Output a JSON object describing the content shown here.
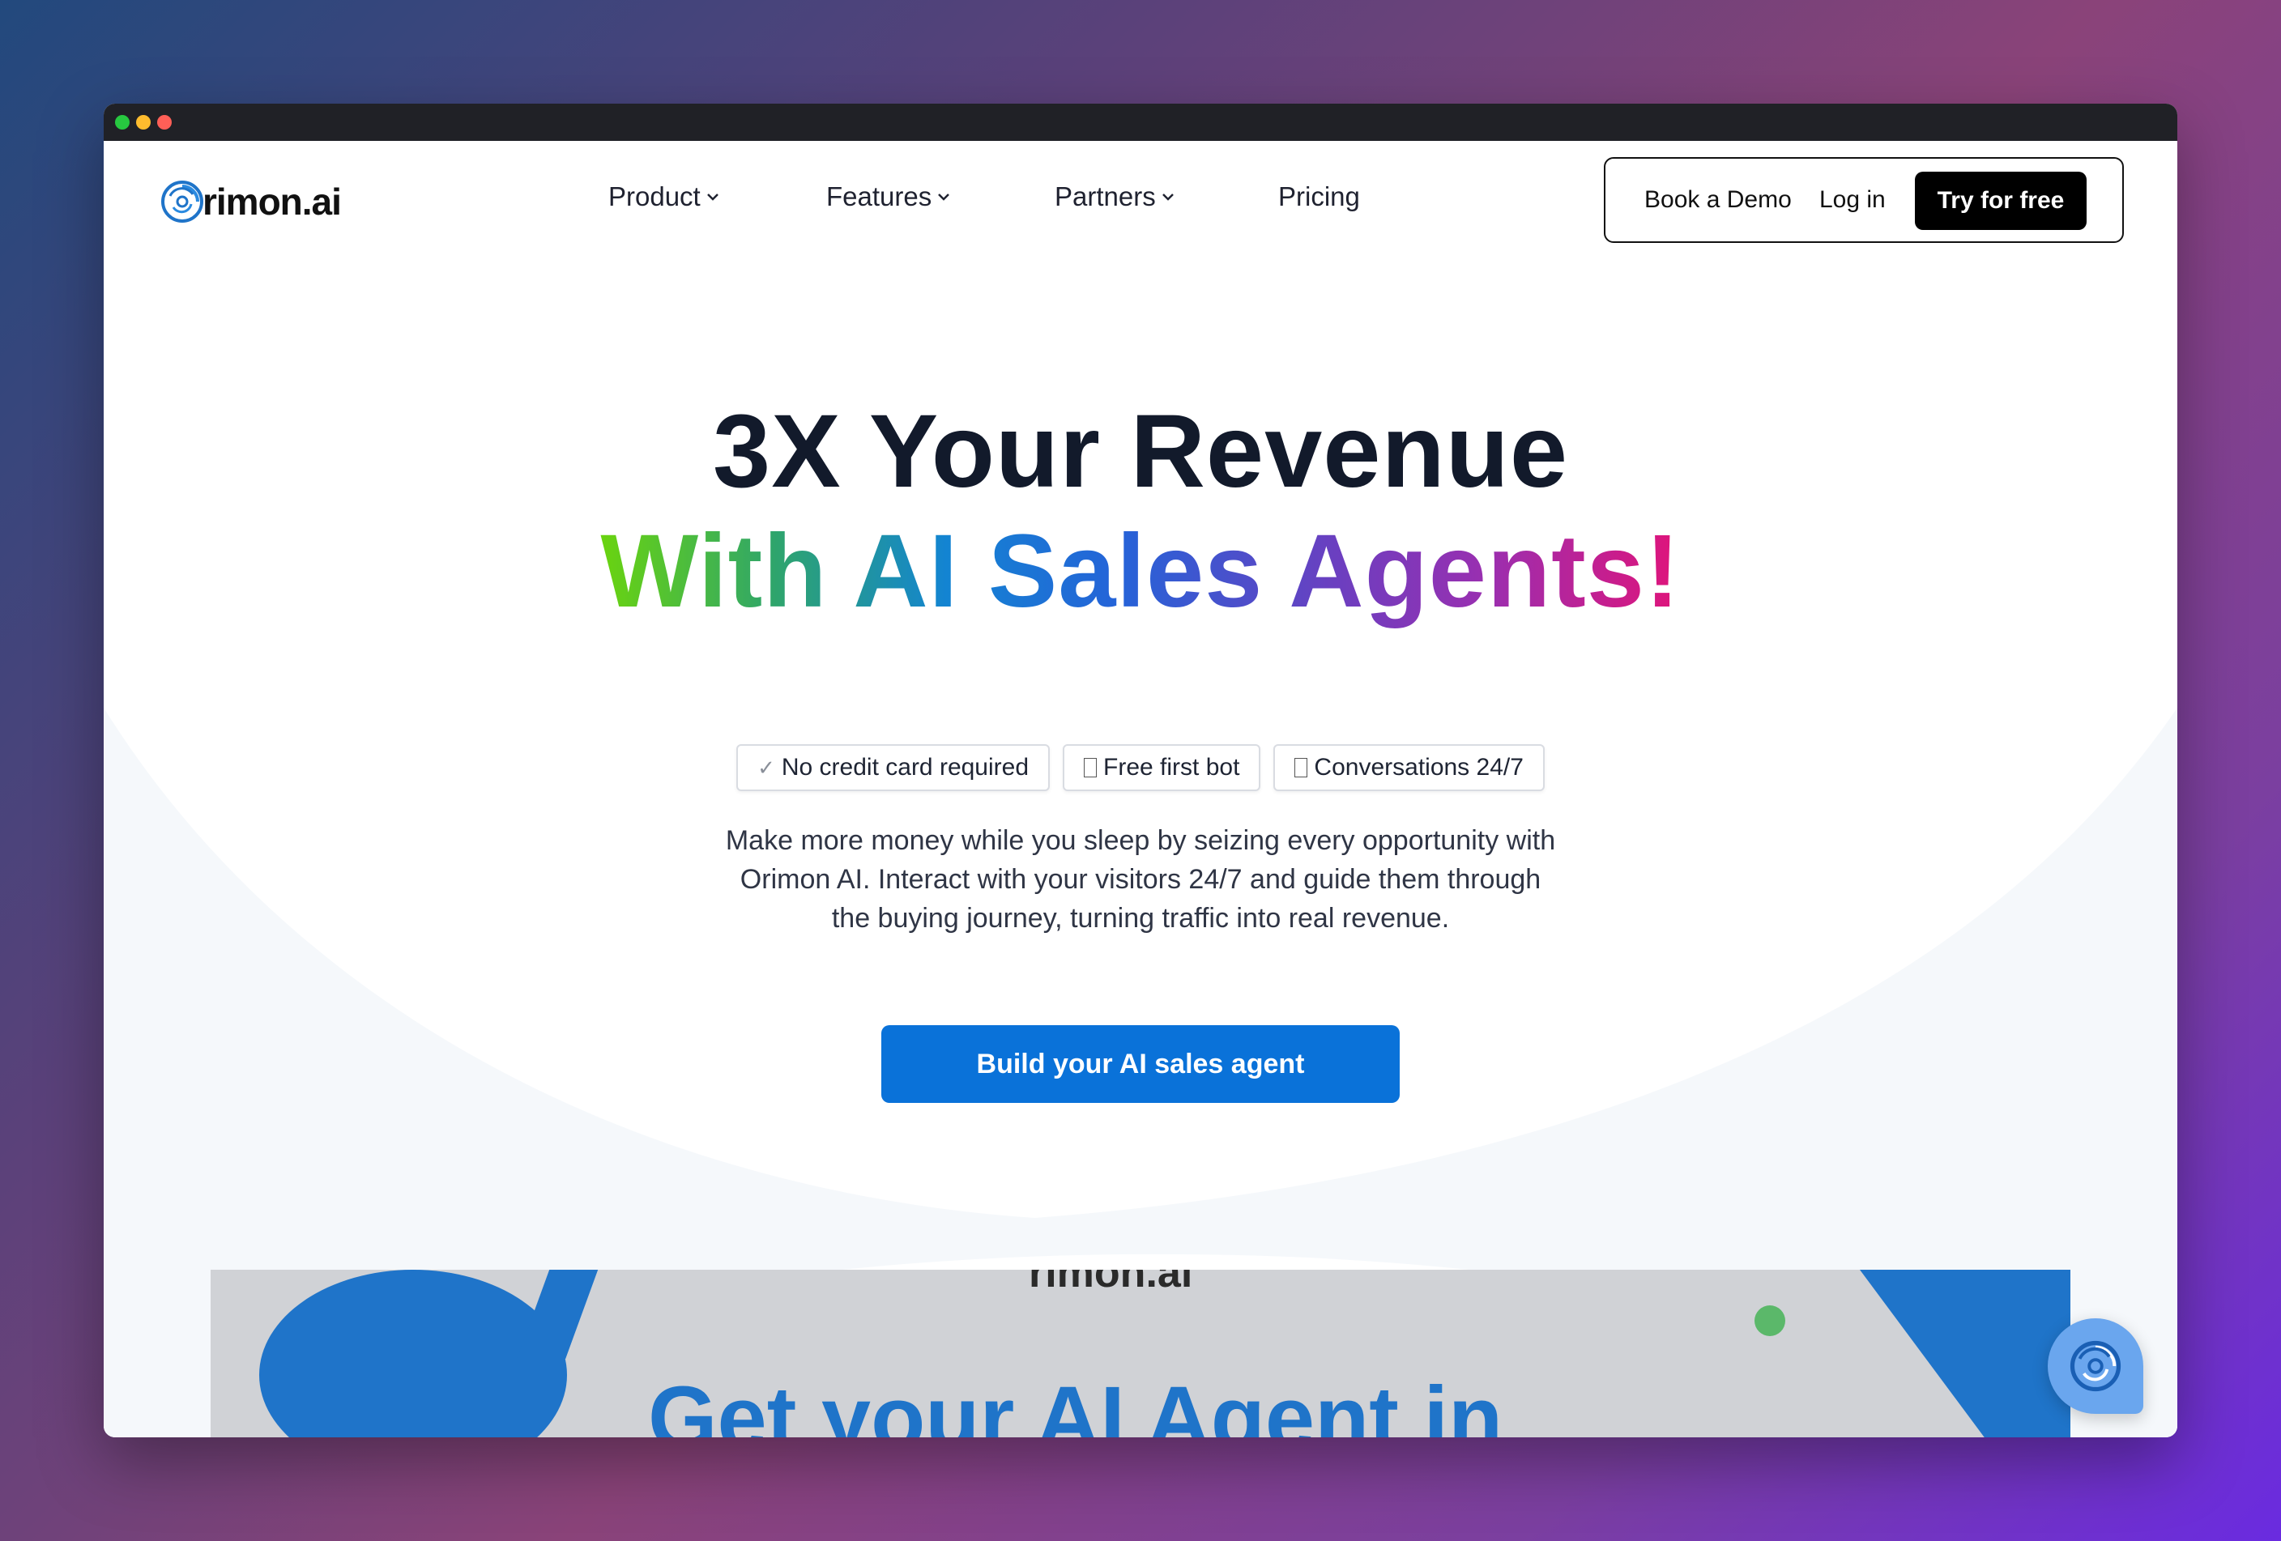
{
  "window": {
    "controls": [
      "close",
      "minimize",
      "maximize"
    ]
  },
  "nav": {
    "logo_text": "rimon.ai",
    "items": [
      {
        "label": "Product",
        "has_dropdown": true
      },
      {
        "label": "Features",
        "has_dropdown": true
      },
      {
        "label": "Partners",
        "has_dropdown": true
      },
      {
        "label": "Pricing",
        "has_dropdown": false
      }
    ],
    "book_demo": "Book a Demo",
    "login": "Log in",
    "try_free": "Try for free"
  },
  "hero": {
    "title_line1": "3X Your Revenue",
    "title_line2": "With AI Sales Agents!",
    "badges": [
      {
        "icon": "check-icon",
        "label": "No credit card required"
      },
      {
        "icon": "unknown-glyph-icon",
        "label": "Free first bot"
      },
      {
        "icon": "unknown-glyph-icon",
        "label": "Conversations 24/7"
      }
    ],
    "description_lines": [
      "Make more money while you sleep by seizing every opportunity with",
      "Orimon AI. Interact with your visitors 24/7 and guide them through",
      "the buying journey, turning traffic into real revenue."
    ],
    "cta": "Build your AI sales agent"
  },
  "preview": {
    "logo_text": "rimon.ai",
    "title": "Get your AI Agent in"
  },
  "colors": {
    "accent": "#0a72d9",
    "dark": "#121a2b",
    "gradient": [
      "#6ad40f",
      "#1384d2",
      "#6b3fc0",
      "#e0147a"
    ]
  }
}
